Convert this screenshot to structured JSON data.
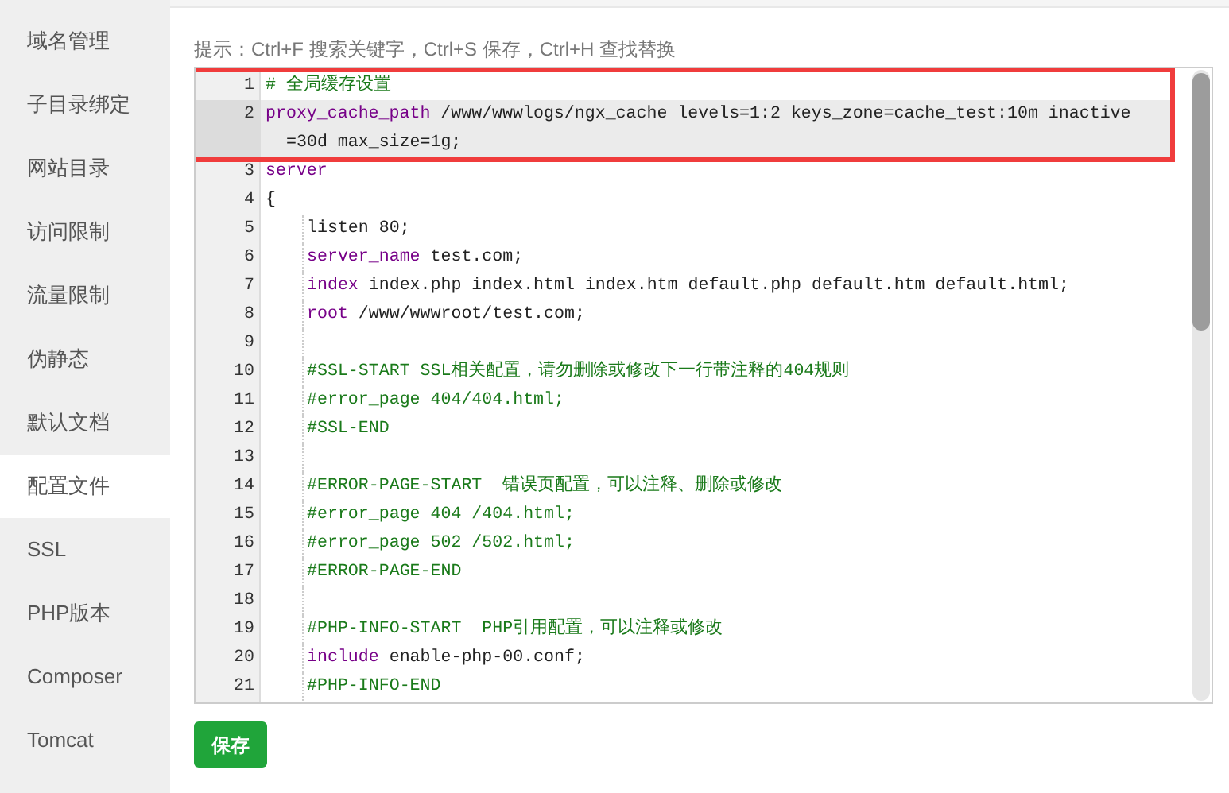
{
  "sidebar": {
    "items": [
      {
        "label": "域名管理",
        "selected": false
      },
      {
        "label": "子目录绑定",
        "selected": false
      },
      {
        "label": "网站目录",
        "selected": false
      },
      {
        "label": "访问限制",
        "selected": false
      },
      {
        "label": "流量限制",
        "selected": false
      },
      {
        "label": "伪静态",
        "selected": false
      },
      {
        "label": "默认文档",
        "selected": false
      },
      {
        "label": "配置文件",
        "selected": true
      },
      {
        "label": "SSL",
        "selected": false
      },
      {
        "label": "PHP版本",
        "selected": false
      },
      {
        "label": "Composer",
        "selected": false
      },
      {
        "label": "Tomcat",
        "selected": false
      }
    ]
  },
  "hint": "提示：Ctrl+F 搜索关键字，Ctrl+S 保存，Ctrl+H 查找替换",
  "editor": {
    "lines": [
      {
        "number": "1",
        "indented": false,
        "highlighted": true,
        "active": false,
        "tokens": [
          {
            "text": "# 全局缓存设置",
            "kind": "comment"
          }
        ]
      },
      {
        "number": "2",
        "indented": false,
        "highlighted": true,
        "active": true,
        "tokens": [
          {
            "text": "proxy_cache_path",
            "kind": "keyword"
          },
          {
            "text": " /www/wwwlogs/ngx_cache levels=1:2 keys_zone=cache_test:10m inactive =30d max_size=1g;",
            "kind": "plain"
          }
        ]
      },
      {
        "number": "3",
        "indented": false,
        "highlighted": false,
        "active": false,
        "tokens": [
          {
            "text": "server",
            "kind": "keyword"
          }
        ]
      },
      {
        "number": "4",
        "indented": false,
        "highlighted": false,
        "active": false,
        "tokens": [
          {
            "text": "{",
            "kind": "plain"
          }
        ]
      },
      {
        "number": "5",
        "indented": true,
        "highlighted": false,
        "active": false,
        "tokens": [
          {
            "text": "listen 80;",
            "kind": "plain"
          }
        ]
      },
      {
        "number": "6",
        "indented": true,
        "highlighted": false,
        "active": false,
        "tokens": [
          {
            "text": "server_name",
            "kind": "keyword"
          },
          {
            "text": " test.com;",
            "kind": "plain"
          }
        ]
      },
      {
        "number": "7",
        "indented": true,
        "highlighted": false,
        "active": false,
        "tokens": [
          {
            "text": "index",
            "kind": "keyword"
          },
          {
            "text": " index.php index.html index.htm default.php default.htm default.html;",
            "kind": "plain"
          }
        ]
      },
      {
        "number": "8",
        "indented": true,
        "highlighted": false,
        "active": false,
        "tokens": [
          {
            "text": "root",
            "kind": "keyword"
          },
          {
            "text": " /www/wwwroot/test.com;",
            "kind": "plain"
          }
        ]
      },
      {
        "number": "9",
        "indented": true,
        "highlighted": false,
        "active": false
      },
      {
        "number": "10",
        "indented": true,
        "highlighted": false,
        "active": false,
        "tokens": [
          {
            "text": "#SSL-START SSL相关配置，请勿删除或修改下一行带注释的404规则",
            "kind": "comment"
          }
        ]
      },
      {
        "number": "11",
        "indented": true,
        "highlighted": false,
        "active": false,
        "tokens": [
          {
            "text": "#error_page 404/404.html;",
            "kind": "comment"
          }
        ]
      },
      {
        "number": "12",
        "indented": true,
        "highlighted": false,
        "active": false,
        "tokens": [
          {
            "text": "#SSL-END",
            "kind": "comment"
          }
        ]
      },
      {
        "number": "13",
        "indented": true,
        "highlighted": false,
        "active": false
      },
      {
        "number": "14",
        "indented": true,
        "highlighted": false,
        "active": false,
        "tokens": [
          {
            "text": "#ERROR-PAGE-START  错误页配置，可以注释、删除或修改",
            "kind": "comment"
          }
        ]
      },
      {
        "number": "15",
        "indented": true,
        "highlighted": false,
        "active": false,
        "tokens": [
          {
            "text": "#error_page 404 /404.html;",
            "kind": "comment"
          }
        ]
      },
      {
        "number": "16",
        "indented": true,
        "highlighted": false,
        "active": false,
        "tokens": [
          {
            "text": "#error_page 502 /502.html;",
            "kind": "comment"
          }
        ]
      },
      {
        "number": "17",
        "indented": true,
        "highlighted": false,
        "active": false,
        "tokens": [
          {
            "text": "#ERROR-PAGE-END",
            "kind": "comment"
          }
        ]
      },
      {
        "number": "18",
        "indented": true,
        "highlighted": false,
        "active": false
      },
      {
        "number": "19",
        "indented": true,
        "highlighted": false,
        "active": false,
        "tokens": [
          {
            "text": "#PHP-INFO-START  PHP引用配置，可以注释或修改",
            "kind": "comment"
          }
        ]
      },
      {
        "number": "20",
        "indented": true,
        "highlighted": false,
        "active": false,
        "tokens": [
          {
            "text": "include",
            "kind": "keyword"
          },
          {
            "text": " enable-php-00.conf;",
            "kind": "plain"
          }
        ]
      },
      {
        "number": "21",
        "indented": true,
        "highlighted": false,
        "active": false,
        "tokens": [
          {
            "text": "#PHP-INFO-END",
            "kind": "comment"
          }
        ]
      }
    ]
  },
  "save_button": "保存"
}
